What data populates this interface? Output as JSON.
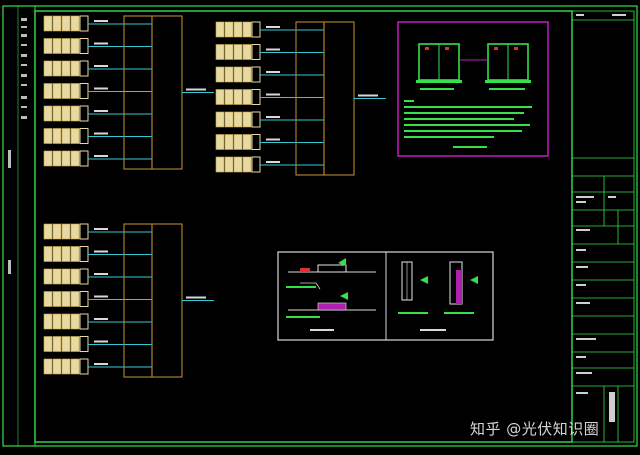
{
  "drawing": {
    "colors": {
      "background": "#000000",
      "frame": "#35e04a",
      "inverter_fill": "#e7d9a2",
      "inverter_stroke": "#c8a64a",
      "combiner_box": "#b8862e",
      "cable": "#35c8d6",
      "detail_border": "#c21cc0",
      "note_text": "#35e04a",
      "label_text": "#d8d8d8"
    },
    "groups": [
      {
        "id": "group-top-left",
        "inverter_rows": 7
      },
      {
        "id": "group-top-middle",
        "inverter_rows": 7
      },
      {
        "id": "group-bottom-left",
        "inverter_rows": 7
      }
    ],
    "details": [
      {
        "id": "combiner-cabinet-detail",
        "cabinets": 2
      },
      {
        "id": "cable-installation-detail",
        "panels": 2
      }
    ]
  },
  "watermark": {
    "text": "知乎 @光伏知识圈"
  }
}
